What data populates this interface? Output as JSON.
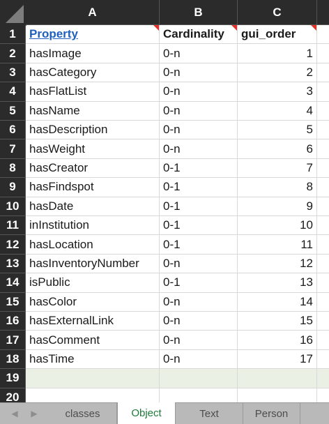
{
  "columns": [
    "A",
    "B",
    "C"
  ],
  "rows": [
    {
      "num": "1",
      "a": "Property",
      "b": "Cardinality",
      "c": "gui_order"
    },
    {
      "num": "2",
      "a": "hasImage",
      "b": "0-n",
      "c": "1"
    },
    {
      "num": "3",
      "a": "hasCategory",
      "b": "0-n",
      "c": "2"
    },
    {
      "num": "4",
      "a": "hasFlatList",
      "b": "0-n",
      "c": "3"
    },
    {
      "num": "5",
      "a": "hasName",
      "b": "0-n",
      "c": "4"
    },
    {
      "num": "6",
      "a": "hasDescription",
      "b": "0-n",
      "c": "5"
    },
    {
      "num": "7",
      "a": "hasWeight",
      "b": "0-n",
      "c": "6"
    },
    {
      "num": "8",
      "a": "hasCreator",
      "b": "0-1",
      "c": "7"
    },
    {
      "num": "9",
      "a": "hasFindspot",
      "b": "0-1",
      "c": "8"
    },
    {
      "num": "10",
      "a": "hasDate",
      "b": "0-1",
      "c": "9"
    },
    {
      "num": "11",
      "a": "inInstitution",
      "b": "0-1",
      "c": "10"
    },
    {
      "num": "12",
      "a": "hasLocation",
      "b": "0-1",
      "c": "11"
    },
    {
      "num": "13",
      "a": "hasInventoryNumber",
      "b": "0-n",
      "c": "12"
    },
    {
      "num": "14",
      "a": "isPublic",
      "b": "0-1",
      "c": "13"
    },
    {
      "num": "15",
      "a": "hasColor",
      "b": "0-n",
      "c": "14"
    },
    {
      "num": "16",
      "a": "hasExternalLink",
      "b": "0-n",
      "c": "15"
    },
    {
      "num": "17",
      "a": "hasComment",
      "b": "0-n",
      "c": "16"
    },
    {
      "num": "18",
      "a": "hasTime",
      "b": "0-n",
      "c": "17"
    },
    {
      "num": "19",
      "a": "",
      "b": "",
      "c": ""
    },
    {
      "num": "20",
      "a": "",
      "b": "",
      "c": ""
    }
  ],
  "selected_row": "19",
  "tabs": [
    "classes",
    "Object",
    "Text",
    "Person"
  ],
  "active_tab": "Object",
  "colors": {
    "header_bg": "#2b2b2b",
    "link": "#1f5fbf",
    "active_tab_text": "#1e7b3a",
    "note_marker": "#e0302a"
  }
}
